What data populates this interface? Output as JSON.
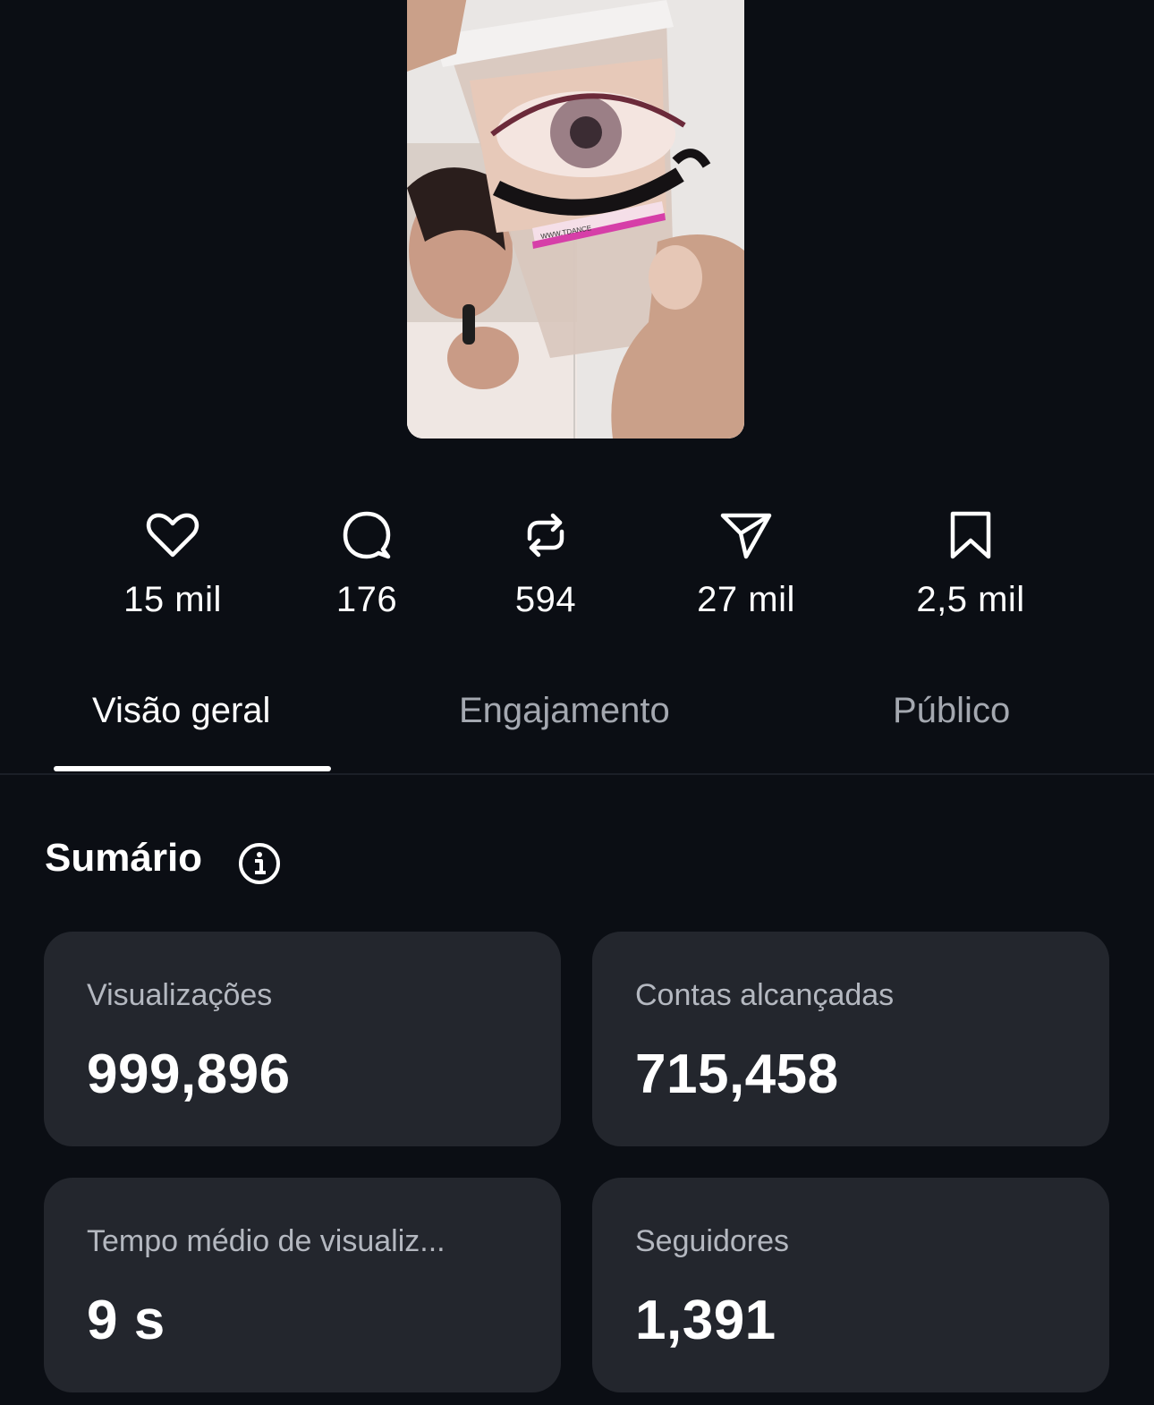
{
  "post": {
    "thumbnail_label": "Post thumbnail",
    "watermark": "WWW.TDANCE"
  },
  "stats": [
    {
      "icon": "heart-icon",
      "value": "15 mil"
    },
    {
      "icon": "comment-icon",
      "value": "176"
    },
    {
      "icon": "repost-icon",
      "value": "594"
    },
    {
      "icon": "share-icon",
      "value": "27 mil"
    },
    {
      "icon": "bookmark-icon",
      "value": "2,5 mil"
    }
  ],
  "tabs": [
    {
      "label": "Visão geral",
      "active": true
    },
    {
      "label": "Engajamento",
      "active": false
    },
    {
      "label": "Público",
      "active": false
    }
  ],
  "summary": {
    "title": "Sumário",
    "cards": [
      {
        "label": "Visualizações",
        "value": "999,896"
      },
      {
        "label": "Contas alcançadas",
        "value": "715,458"
      },
      {
        "label": "Tempo médio de visualiz...",
        "value": "9 s"
      },
      {
        "label": "Seguidores",
        "value": "1,391"
      }
    ]
  },
  "colors": {
    "background": "#0b0e14",
    "card": "#23262d",
    "muted_text": "#a4a8b0"
  }
}
